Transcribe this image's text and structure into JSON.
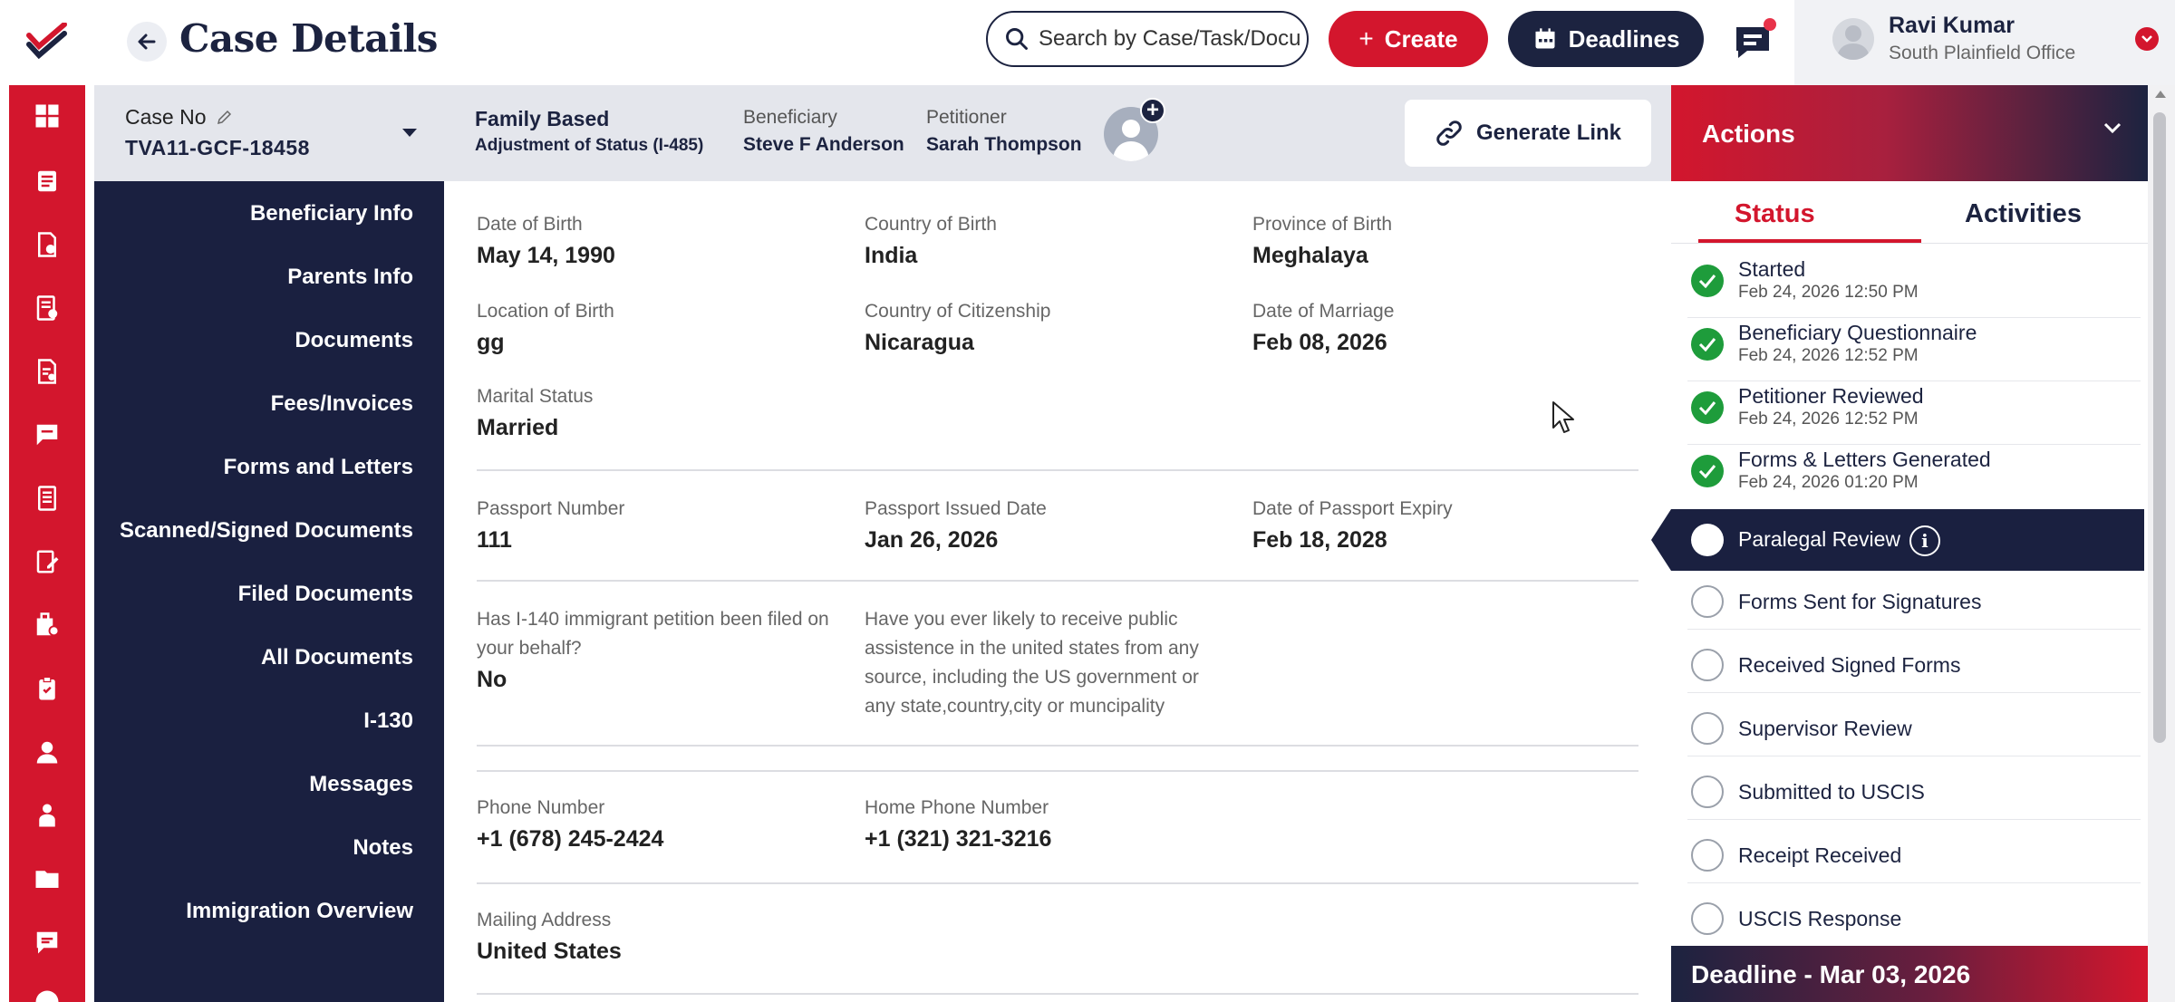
{
  "header": {
    "title": "Case Details",
    "search_placeholder": "Search by Case/Task/Docu",
    "create_label": "Create",
    "deadlines_label": "Deadlines",
    "user_name": "Ravi Kumar",
    "user_office": "South Plainfield Office"
  },
  "case": {
    "case_no_label": "Case No",
    "case_no": "TVA11-GCF-18458",
    "type": "Family Based",
    "subtype": "Adjustment of Status (I-485)",
    "beneficiary_label": "Beneficiary",
    "beneficiary": "Steve F Anderson",
    "petitioner_label": "Petitioner",
    "petitioner": "Sarah Thompson",
    "generate_link_label": "Generate Link"
  },
  "leftnav": [
    "Beneficiary Info",
    "Parents Info",
    "Documents",
    "Fees/Invoices",
    "Forms and Letters",
    "Scanned/Signed Documents",
    "Filed Documents",
    "All Documents",
    "I-130",
    "Messages",
    "Notes",
    "Immigration Overview"
  ],
  "fields": {
    "dob": {
      "label": "Date of Birth",
      "value": "May 14, 1990"
    },
    "country_birth": {
      "label": "Country of Birth",
      "value": "India"
    },
    "province_birth": {
      "label": "Province of Birth",
      "value": "Meghalaya"
    },
    "location_birth": {
      "label": "Location of Birth",
      "value": "gg"
    },
    "citizenship": {
      "label": "Country of Citizenship",
      "value": "Nicaragua"
    },
    "marriage_date": {
      "label": "Date of Marriage",
      "value": "Feb 08, 2026"
    },
    "marital_status": {
      "label": "Marital Status",
      "value": "Married"
    },
    "passport_number": {
      "label": "Passport Number",
      "value": "111"
    },
    "passport_issued": {
      "label": "Passport Issued Date",
      "value": "Jan 26, 2026"
    },
    "passport_expiry": {
      "label": "Date of Passport Expiry",
      "value": "Feb 18, 2028"
    },
    "i140": {
      "label": "Has I-140 immigrant petition been filed on your behalf?",
      "value": "No"
    },
    "public_assist": {
      "label": "Have you ever likely to receive public assistence in the united states from any source, including the US government or any state,country,city or muncipality"
    },
    "phone": {
      "label": "Phone Number",
      "value": "+1  (678) 245-2424"
    },
    "home_phone": {
      "label": "Home Phone Number",
      "value": "+1  (321) 321-3216"
    },
    "mailing": {
      "label": "Mailing Address",
      "value": "United States"
    }
  },
  "actions": {
    "title": "Actions",
    "tab_status": "Status",
    "tab_activities": "Activities",
    "completed": [
      {
        "title": "Started",
        "time": "Feb 24, 2026 12:50 PM"
      },
      {
        "title": "Beneficiary Questionnaire",
        "time": "Feb 24, 2026 12:52 PM"
      },
      {
        "title": "Petitioner Reviewed",
        "time": "Feb 24, 2026 12:52 PM"
      },
      {
        "title": "Forms & Letters Generated",
        "time": "Feb 24, 2026 01:20 PM"
      }
    ],
    "active": "Paralegal Review",
    "pending": [
      "Forms Sent for Signatures",
      "Received Signed Forms",
      "Supervisor Review",
      "Submitted to USCIS",
      "Receipt Received",
      "USCIS Response"
    ],
    "deadline": "Deadline - Mar 03, 2026"
  },
  "colors": {
    "brand_red": "#d3162d",
    "navy": "#1c2340",
    "success_green": "#1e9c3b"
  }
}
